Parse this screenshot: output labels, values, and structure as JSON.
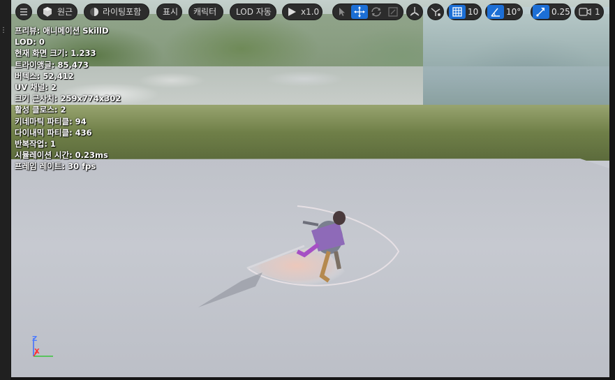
{
  "toolbar": {
    "menu_icon": "hamburger-menu-icon",
    "perspective_label": "원근",
    "lighting_label": "라이팅포함",
    "show_label": "표시",
    "character_label": "캐릭터",
    "lod_label": "LOD 자동",
    "playback_speed": "x1.0",
    "grid_snap_value": "10",
    "rotation_snap_value": "10°",
    "scale_snap_value": "0.25",
    "camera_speed_value": "1"
  },
  "stats": [
    "프리뷰: 애니메이션 SkillD",
    "LOD: 0",
    "현재 화면 크기: 1.233",
    "트라이앵글: 85,473",
    "버텍스: 52,412",
    "UV 채널: 2",
    "크기 근사치: 259x774x302",
    "활성 클로스: 2",
    "키네마틱 파티클: 94",
    "다이내믹 파티클: 436",
    "반복작업: 1",
    "시뮬레이션 시간: 0.23ms",
    "프레임 레이트: 30 fps"
  ],
  "gizmo": {
    "z_label": "Z",
    "x_label": "X"
  },
  "colors": {
    "accent": "#1c6fd6",
    "toolbar_bg": "#2c2c2c",
    "floor": "#c4c7ce"
  }
}
